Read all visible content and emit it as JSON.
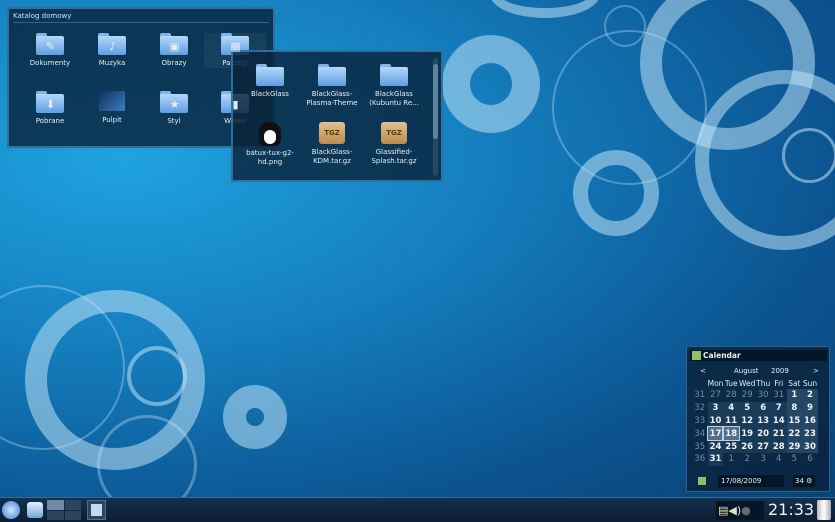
{
  "folderview_home": {
    "title": "Katalog domowy",
    "items": [
      {
        "label": "Dokumenty",
        "icon": "folder-documents-icon",
        "glyph": "✎"
      },
      {
        "label": "Muzyka",
        "icon": "folder-music-icon",
        "glyph": "♪"
      },
      {
        "label": "Obrazy",
        "icon": "folder-images-icon",
        "glyph": "▣"
      },
      {
        "label": "Pakiety",
        "icon": "folder-packages-icon",
        "glyph": "▦"
      },
      {
        "label": "Pobrane",
        "icon": "folder-downloads-icon",
        "glyph": "⬇"
      },
      {
        "label": "Pulpit",
        "icon": "folder-desktop-icon",
        "glyph": ""
      },
      {
        "label": "Styl",
        "icon": "folder-style-icon",
        "glyph": "★"
      },
      {
        "label": "Wideo",
        "icon": "folder-video-icon",
        "glyph": "▮"
      }
    ]
  },
  "folderview_packages": {
    "items": [
      {
        "label": "BlackGlass",
        "type": "folder"
      },
      {
        "label": "BlackGlass-Plasma-Theme",
        "type": "folder"
      },
      {
        "label": "BlackGlass (Kubuntu Re...",
        "type": "folder"
      },
      {
        "label": "batux-tux-g2-hd.png",
        "type": "image"
      },
      {
        "label": "BlackGlass-KDM.tar.gz",
        "type": "tgz"
      },
      {
        "label": "Glassified-Splash.tar.gz",
        "type": "tgz"
      }
    ],
    "tgz_label": "TGZ"
  },
  "calendar": {
    "title": "Calendar",
    "prev": "<",
    "next": ">",
    "month": "August",
    "year": "2009",
    "weekdays": [
      "Mon",
      "Tue",
      "Wed",
      "Thu",
      "Fri",
      "Sat",
      "Sun"
    ],
    "weeks": [
      {
        "n": "31",
        "days": [
          "27",
          "28",
          "29",
          "30",
          "31",
          "1",
          "2"
        ]
      },
      {
        "n": "32",
        "days": [
          "3",
          "4",
          "5",
          "6",
          "7",
          "8",
          "9"
        ]
      },
      {
        "n": "33",
        "days": [
          "10",
          "11",
          "12",
          "13",
          "14",
          "15",
          "16"
        ]
      },
      {
        "n": "34",
        "days": [
          "17",
          "18",
          "19",
          "20",
          "21",
          "22",
          "23"
        ]
      },
      {
        "n": "35",
        "days": [
          "24",
          "25",
          "26",
          "27",
          "28",
          "29",
          "30"
        ]
      },
      {
        "n": "36",
        "days": [
          "31",
          "1",
          "2",
          "3",
          "4",
          "5",
          "6"
        ]
      }
    ],
    "selected_day": "17",
    "date_value": "17/08/2009",
    "week_value": "34"
  },
  "panel": {
    "clock": "21:33"
  },
  "colors": {
    "accent": "#1fa3df",
    "panel": "#0b1e33"
  }
}
